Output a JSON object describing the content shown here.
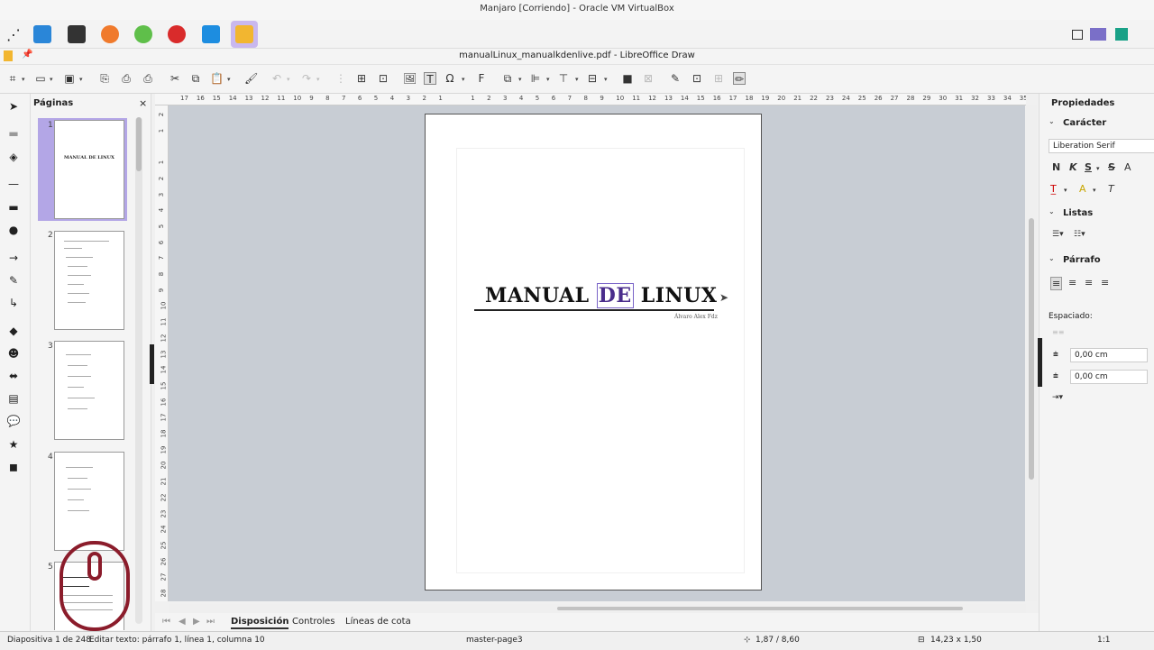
{
  "vm": {
    "title": "Manjaro [Corriendo] - Oracle VM VirtualBox"
  },
  "window": {
    "title": "manualLinux_manualkdenlive.pdf - LibreOffice Draw"
  },
  "pages_panel": {
    "title": "Páginas",
    "close": "×",
    "items": [
      {
        "number": "1",
        "thumb_title": "MANUAL DE LINUX"
      },
      {
        "number": "2"
      },
      {
        "number": "3"
      },
      {
        "number": "4"
      },
      {
        "number": "5"
      }
    ]
  },
  "document": {
    "title_before": "MANUAL ",
    "title_selected": "DE",
    "title_after": " LINUX",
    "author": "Álvaro Alex Fdz"
  },
  "ruler": {
    "h_labels": [
      "17",
      "16",
      "15",
      "14",
      "13",
      "12",
      "11",
      "10",
      "9",
      "8",
      "7",
      "6",
      "5",
      "4",
      "3",
      "2",
      "1",
      "",
      "1",
      "2",
      "3",
      "4",
      "5",
      "6",
      "7",
      "8",
      "9",
      "10",
      "11",
      "12",
      "13",
      "14",
      "15",
      "16",
      "17",
      "18",
      "19",
      "20",
      "21",
      "22",
      "23",
      "24",
      "25",
      "26",
      "27",
      "28",
      "29",
      "30",
      "31",
      "32",
      "33",
      "34",
      "35"
    ],
    "v_labels": [
      "2",
      "1",
      "",
      "1",
      "2",
      "3",
      "4",
      "5",
      "6",
      "7",
      "8",
      "9",
      "10",
      "11",
      "12",
      "13",
      "14",
      "15",
      "16",
      "17",
      "18",
      "19",
      "20",
      "21",
      "22",
      "23",
      "24",
      "25",
      "26",
      "27",
      "28"
    ]
  },
  "tabs": {
    "layout": "Disposición",
    "controls": "Controles",
    "dimension_lines": "Líneas de cota"
  },
  "sidebar": {
    "title": "Propiedades",
    "character": "Carácter",
    "font_name": "Liberation Serif",
    "bold": "N",
    "italic": "K",
    "underline": "S",
    "strike": "S",
    "shadow": "A",
    "lists": "Listas",
    "paragraph": "Párrafo",
    "spacing": "Espaciado:",
    "spacing_above": "0,00 cm",
    "spacing_below": "0,00 cm"
  },
  "status": {
    "slide": "Diapositiva 1 de 248",
    "edit": "Editar texto: párrafo 1, línea 1, columna 10",
    "master": "master-page3",
    "position": "1,87 / 8,60",
    "size": "14,23 x 1,50",
    "zoom": "1:1"
  },
  "colors": {
    "accent": "#b3a6e6",
    "selection_text": "#4a2d8c",
    "mouse_overlay": "#8b1c2b"
  }
}
